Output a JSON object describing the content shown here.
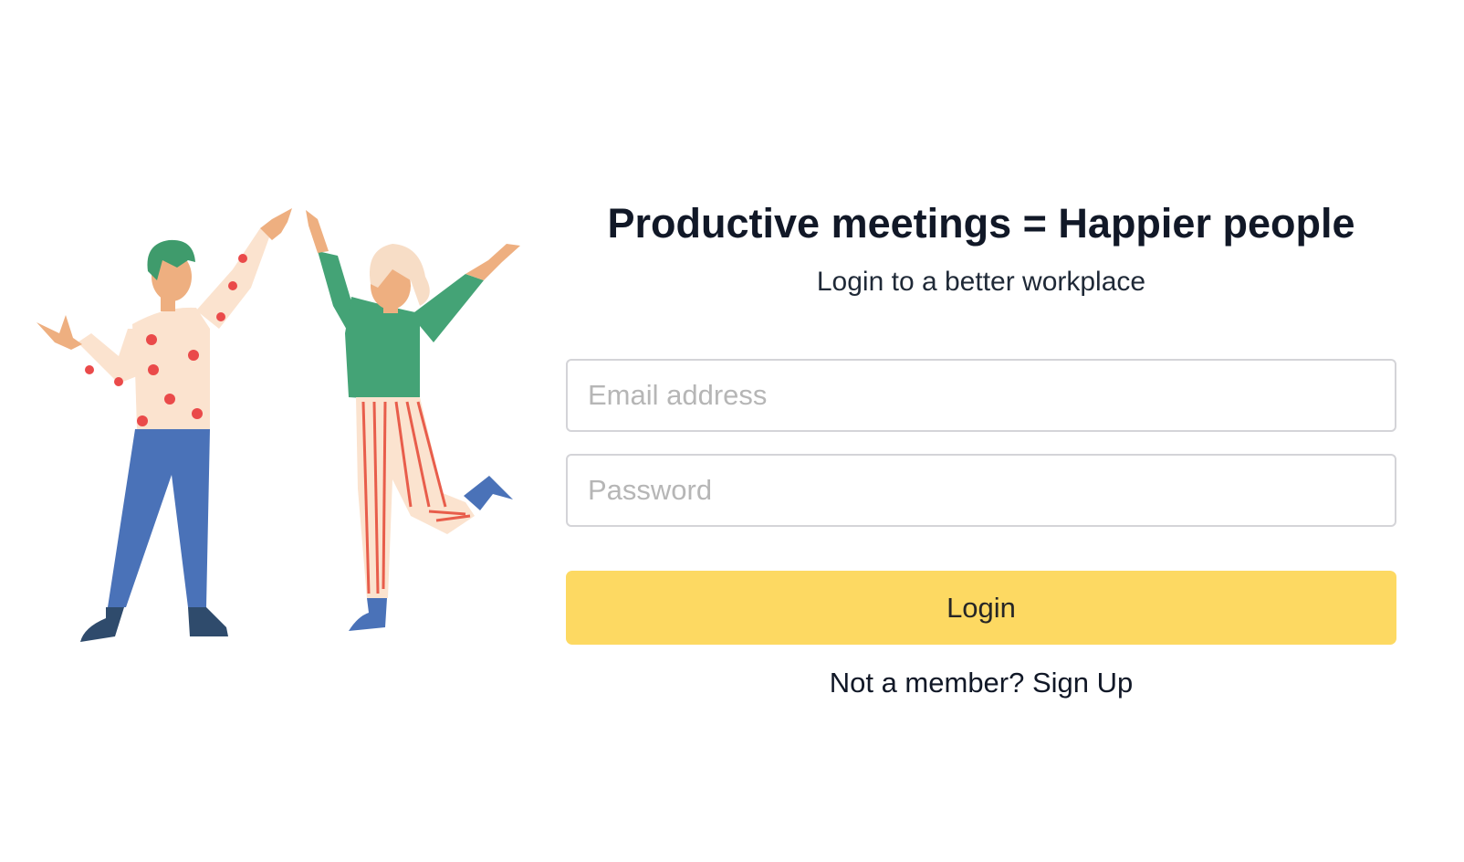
{
  "hero": {
    "title": "Productive meetings = Happier people",
    "subtitle": "Login to a better workplace"
  },
  "form": {
    "email_placeholder": "Email address",
    "email_value": "",
    "password_placeholder": "Password",
    "password_value": "",
    "login_label": "Login",
    "signup_prompt": "Not a member?",
    "signup_link": "Sign Up"
  },
  "illustration": {
    "subject": "two-people-celebrating-illustration"
  },
  "colors": {
    "button": "#fdd962",
    "title": "#111827",
    "placeholder": "#b6b6b6",
    "border": "#d4d4d8",
    "man_sweater": "#fbe3cf",
    "man_dots": "#ea4a4a",
    "man_pants": "#4a72b8",
    "man_hair": "#3f9b6c",
    "woman_top": "#44a376",
    "woman_pants_stripe": "#e85d4b",
    "woman_hair": "#f7ddc6",
    "skin": "#eeaf80",
    "shoes": "#2f4b6c"
  }
}
